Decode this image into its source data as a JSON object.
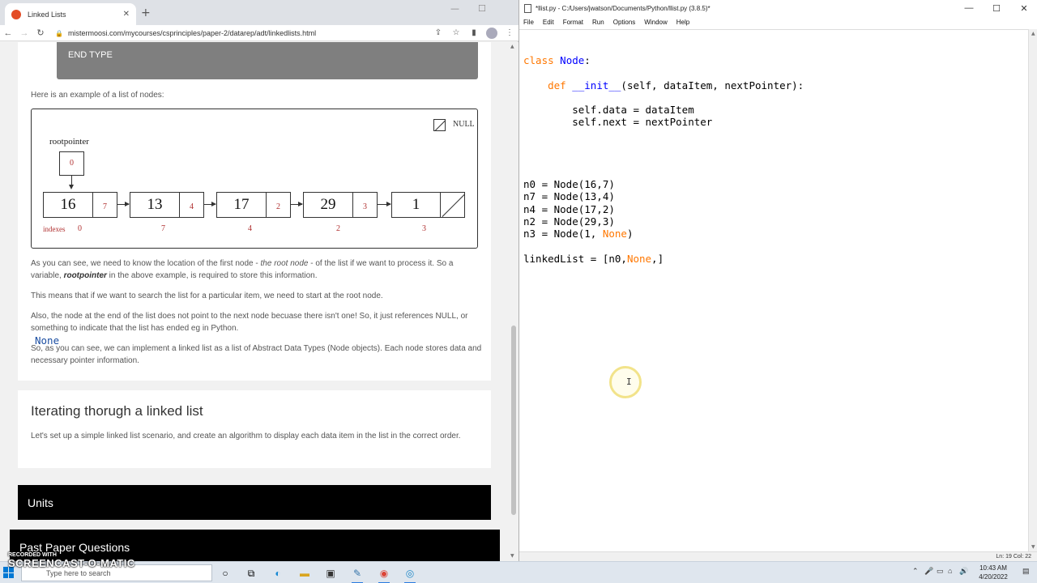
{
  "browser": {
    "tab_title": "Linked Lists",
    "tab_close": "✕",
    "new_tab": "+",
    "url": "mistermoosi.com/mycourses/csprinciples/paper-2/datarep/adt/linkedlists.html",
    "window_controls": [
      "—",
      "☐"
    ]
  },
  "page": {
    "end_type": "END TYPE",
    "intro": "Here is an example of a list of nodes:",
    "diagram": {
      "null_label": "NULL",
      "root_label": "rootpointer",
      "root_value": "0",
      "nodes": [
        {
          "value": "16",
          "pointer": "7"
        },
        {
          "value": "13",
          "pointer": "4"
        },
        {
          "value": "17",
          "pointer": "2"
        },
        {
          "value": "29",
          "pointer": "3"
        },
        {
          "value": "1",
          "pointer": ""
        }
      ],
      "indexes_label": "indexes",
      "indexes": [
        "0",
        "7",
        "4",
        "2",
        "3"
      ]
    },
    "para1": {
      "a": "As you can see, we need to know the location of the first node - ",
      "b": "the root node",
      "c": " - of the list if we want to process it. So a variable, ",
      "d": "rootpointer",
      "e": " in the above example, is required to store this information."
    },
    "para2": "This means that if we want to search the list for a particular item, we need to start at the root node.",
    "para3": {
      "a": "Also, the node at the end of the list does not point to the next node becuase there isn't one! So, it just references NULL, or something to indicate that the list has ended eg ",
      "b": "None",
      "c": " in Python."
    },
    "para4": "So, as you can see, we can implement a linked list as a list of Abstract Data Types (Node objects). Each node stores data and necessary pointer information.",
    "section_heading": "Iterating thorugh a linked list",
    "section_text": "Let's set up a simple linked list scenario, and create an algorithm to display each data item in the list in the correct order.",
    "units_label": "Units",
    "past_papers_label": "Past Paper Questions"
  },
  "idle": {
    "title": "*llist.py - C:/Users/jwatson/Documents/Python/llist.py (3.8.5)*",
    "menu": [
      "File",
      "Edit",
      "Format",
      "Run",
      "Options",
      "Window",
      "Help"
    ],
    "window_controls": [
      "—",
      "☐",
      "✕"
    ],
    "code": {
      "l1_kw": "class",
      "l1_name": " Node",
      "l1_rest": ":",
      "l2_indent": "    ",
      "l2_kw": "def",
      "l2_name": " __init__",
      "l2_rest": "(self, dataItem, nextPointer):",
      "l3": "        self.data = dataItem",
      "l4": "        self.next = nextPointer",
      "l5": "n0 = Node(16,7)",
      "l6": "n7 = Node(13,4)",
      "l7": "n4 = Node(17,2)",
      "l8": "n2 = Node(29,3)",
      "l9_a": "n3 = Node(1, ",
      "l9_none": "None",
      "l9_b": ")",
      "l10_a": "linkedList = [n0,",
      "l10_none": "None",
      "l10_b": ",]"
    },
    "status": "Ln: 19   Col: 22"
  },
  "taskbar": {
    "search_placeholder": "Type here to search",
    "watermark_top": "RECORDED WITH",
    "watermark_brand": "SCREENCAST-O-MATIC",
    "time": "10:43 AM",
    "date": "4/20/2022"
  },
  "colors": {
    "accent": "#0078d4",
    "code_keyword": "#ff7700",
    "code_defname": "#0000ff",
    "diagram_red": "#b03030"
  }
}
